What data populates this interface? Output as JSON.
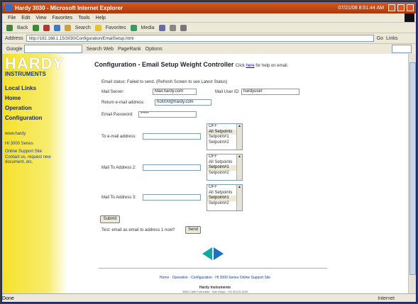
{
  "window": {
    "title": "Hardy 3030 - Microsoft Internet Explorer",
    "clock": "07/21/08 8:51:44 AM"
  },
  "menu": [
    "File",
    "Edit",
    "View",
    "Favorites",
    "Tools",
    "Help"
  ],
  "toolbar": {
    "back": "Back",
    "search": "Search",
    "favorites": "Favorites",
    "media": "Media"
  },
  "address": {
    "label": "Address",
    "url": "http://192.168.1.15/3030/Configuration/EmailSetup.html",
    "go": "Go",
    "links": "Links"
  },
  "googlebar": {
    "label": "Google",
    "search_web": "Search Web",
    "pagerank": "PageRank",
    "options": "Options"
  },
  "sidebar": {
    "brand_top": "HARDY",
    "brand_bottom": "INSTRUMENTS",
    "nav": [
      "Local Links",
      "Home",
      "Operation",
      "Configuration"
    ],
    "links": [
      "www.hardy",
      "HI 3000 Series",
      "Online Support Site",
      "Contact us, request new document, etc."
    ]
  },
  "page": {
    "title": "Configuration - Email Setup Weight Controller",
    "help_prefix": "Click",
    "help_link": "here",
    "help_suffix": "for help on email.",
    "email_status": "Email status: Failed to send. (Refresh Screen to see Latest Status)",
    "mail_server_label": "Mail Server:",
    "mail_server_value": "Mail.hardy.com",
    "mail_user_id_label": "Mail User ID:",
    "mail_user_id_value": "hardyuser",
    "return_address_label": "Return e-mail address:",
    "return_address_value": "hi3000@hardy.com",
    "password_label": "Email Password:",
    "password_value": "*****",
    "to_address_label": "To e-mail address:",
    "to_address_value": "",
    "list1": {
      "options": [
        "OFF",
        "All Setpoints",
        "Setpoint#1",
        "Setpoint#2"
      ],
      "selected": 1
    },
    "to_address2_label": "Mail To Address 2:",
    "to_address2_value": "",
    "list2": {
      "options": [
        "OFF",
        "All Setpoints",
        "Setpoint#1",
        "Setpoint#2"
      ],
      "selected": 2
    },
    "to_address3_label": "Mail To Address 3:",
    "to_address3_value": "",
    "list3": {
      "options": [
        "OFF",
        "All Setpoints",
        "Setpoint#1",
        "Setpoint#2"
      ],
      "selected": 2
    },
    "submit_label": "Submit",
    "test_text": "Test: email as email to address 1 now?",
    "test_button": "Send",
    "footer_links": "Home · Operation · Configuration · HI 3000 Series Online Support Site",
    "footer_company": "Hardy Instruments",
    "footer_address": "3860 Calle Fortunada · San Diego · CA 92123-1825"
  },
  "statusbar": {
    "done": "Done",
    "zone": "Internet"
  },
  "colors": {
    "sidebar_yellow": "#f5e12a",
    "arrow_blue": "#1d6fc9",
    "arrow_teal": "#10a8a0",
    "title_bar": "#c24616"
  }
}
